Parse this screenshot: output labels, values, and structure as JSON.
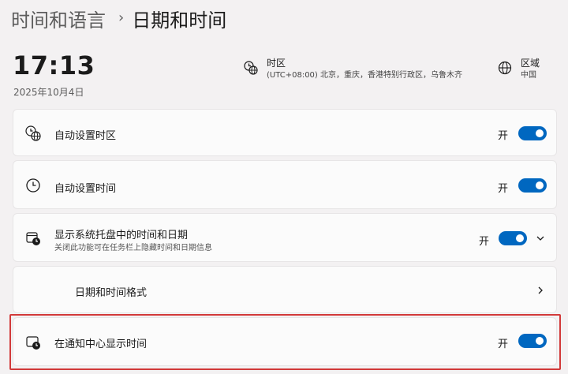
{
  "header": {
    "parent": "时间和语言",
    "separator": "›",
    "current": "日期和时间"
  },
  "clock": {
    "time": "17:13",
    "date": "2025年10月4日"
  },
  "timezone": {
    "title": "时区",
    "value": "(UTC+08:00) 北京，重庆，香港特别行政区，乌鲁木齐",
    "icon": "globe-clock-icon"
  },
  "region": {
    "title": "区域",
    "value": "中国",
    "icon": "globe-icon"
  },
  "settings": [
    {
      "label": "自动设置时区",
      "state": "开",
      "enabled": true,
      "icon": "globe-clock-icon"
    },
    {
      "label": "自动设置时间",
      "state": "开",
      "enabled": true,
      "icon": "clock-icon"
    },
    {
      "label": "显示系统托盘中的时间和日期",
      "description": "关闭此功能可在任务栏上隐藏时间和日期信息",
      "state": "开",
      "enabled": true,
      "icon": "calendar-clock-icon",
      "expandable": true
    },
    {
      "label": "日期和时间格式",
      "icon": "none",
      "navigates": true
    },
    {
      "label": "在通知中心显示时间",
      "state": "开",
      "enabled": true,
      "icon": "notification-clock-icon"
    }
  ],
  "colors": {
    "accent": "#0067c0",
    "highlight_border": "#d23a3a",
    "background": "#f3f1f2",
    "card": "#fbfbfb"
  }
}
